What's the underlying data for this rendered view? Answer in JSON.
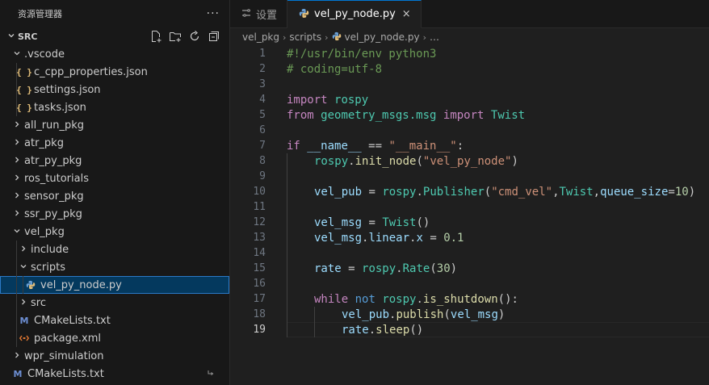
{
  "explorer": {
    "title": "资源管理器",
    "more": "···",
    "section": "SRC",
    "tree": [
      {
        "label": ".vscode",
        "type": "folder",
        "open": true,
        "depth": 1
      },
      {
        "label": "c_cpp_properties.json",
        "type": "json",
        "depth": 2
      },
      {
        "label": "settings.json",
        "type": "json",
        "depth": 2
      },
      {
        "label": "tasks.json",
        "type": "json",
        "depth": 2
      },
      {
        "label": "all_run_pkg",
        "type": "folder",
        "open": false,
        "depth": 1
      },
      {
        "label": "atr_pkg",
        "type": "folder",
        "open": false,
        "depth": 1
      },
      {
        "label": "atr_py_pkg",
        "type": "folder",
        "open": false,
        "depth": 1
      },
      {
        "label": "ros_tutorials",
        "type": "folder",
        "open": false,
        "depth": 1
      },
      {
        "label": "sensor_pkg",
        "type": "folder",
        "open": false,
        "depth": 1
      },
      {
        "label": "ssr_py_pkg",
        "type": "folder",
        "open": false,
        "depth": 1
      },
      {
        "label": "vel_pkg",
        "type": "folder",
        "open": true,
        "depth": 1
      },
      {
        "label": "include",
        "type": "folder",
        "open": false,
        "depth": 2
      },
      {
        "label": "scripts",
        "type": "folder",
        "open": true,
        "depth": 2
      },
      {
        "label": "vel_py_node.py",
        "type": "python",
        "depth": 3,
        "selected": true
      },
      {
        "label": "src",
        "type": "folder",
        "open": false,
        "depth": 2
      },
      {
        "label": "CMakeLists.txt",
        "type": "cmake",
        "depth": 2
      },
      {
        "label": "package.xml",
        "type": "xml",
        "depth": 2
      },
      {
        "label": "wpr_simulation",
        "type": "folder",
        "open": false,
        "depth": 1
      },
      {
        "label": "CMakeLists.txt",
        "type": "cmake",
        "depth": 1,
        "linked": true
      }
    ]
  },
  "tabs": [
    {
      "label": "设置",
      "icon": "settings-icon",
      "active": false
    },
    {
      "label": "vel_py_node.py",
      "icon": "python-icon",
      "active": true,
      "close": "×"
    }
  ],
  "breadcrumb": [
    "vel_pkg",
    "scripts",
    "vel_py_node.py",
    "…"
  ],
  "editor": {
    "current_line": 19,
    "lines": [
      {
        "n": "1",
        "indent": 0,
        "tokens": [
          [
            "cm",
            "#!/usr/bin/env python3"
          ]
        ]
      },
      {
        "n": "2",
        "indent": 0,
        "tokens": [
          [
            "cm",
            "# coding=utf-8"
          ]
        ]
      },
      {
        "n": "3",
        "indent": 0,
        "tokens": []
      },
      {
        "n": "4",
        "indent": 0,
        "tokens": [
          [
            "kw",
            "import"
          ],
          [
            "",
            " "
          ],
          [
            "md",
            "rospy"
          ]
        ]
      },
      {
        "n": "5",
        "indent": 0,
        "tokens": [
          [
            "kw",
            "from"
          ],
          [
            "",
            " "
          ],
          [
            "md",
            "geometry_msgs.msg"
          ],
          [
            "",
            " "
          ],
          [
            "kw",
            "import"
          ],
          [
            "",
            " "
          ],
          [
            "md",
            "Twist"
          ]
        ]
      },
      {
        "n": "6",
        "indent": 0,
        "tokens": []
      },
      {
        "n": "7",
        "indent": 0,
        "tokens": [
          [
            "kw",
            "if"
          ],
          [
            "",
            " "
          ],
          [
            "vr",
            "__name__"
          ],
          [
            "",
            " == "
          ],
          [
            "st",
            "\"__main__\""
          ],
          [
            "",
            ":"
          ]
        ]
      },
      {
        "n": "8",
        "indent": 1,
        "tokens": [
          [
            "md",
            "rospy"
          ],
          [
            "",
            "."
          ],
          [
            "fn",
            "init_node"
          ],
          [
            "",
            "("
          ],
          [
            "st",
            "\"vel_py_node\""
          ],
          [
            "",
            ")"
          ]
        ]
      },
      {
        "n": "9",
        "indent": 1,
        "tokens": []
      },
      {
        "n": "10",
        "indent": 1,
        "tokens": [
          [
            "vr",
            "vel_pub"
          ],
          [
            "",
            " = "
          ],
          [
            "md",
            "rospy"
          ],
          [
            "",
            "."
          ],
          [
            "md",
            "Publisher"
          ],
          [
            "",
            "("
          ],
          [
            "st",
            "\"cmd_vel\""
          ],
          [
            "",
            ","
          ],
          [
            "md",
            "Twist"
          ],
          [
            "",
            ","
          ],
          [
            "vr",
            "queue_size"
          ],
          [
            "",
            "="
          ],
          [
            "nm",
            "10"
          ],
          [
            "",
            ")"
          ]
        ]
      },
      {
        "n": "11",
        "indent": 1,
        "tokens": []
      },
      {
        "n": "12",
        "indent": 1,
        "tokens": [
          [
            "vr",
            "vel_msg"
          ],
          [
            "",
            " = "
          ],
          [
            "md",
            "Twist"
          ],
          [
            "",
            "()"
          ]
        ]
      },
      {
        "n": "13",
        "indent": 1,
        "tokens": [
          [
            "vr",
            "vel_msg"
          ],
          [
            "",
            "."
          ],
          [
            "vr",
            "linear"
          ],
          [
            "",
            "."
          ],
          [
            "vr",
            "x"
          ],
          [
            "",
            " = "
          ],
          [
            "nm",
            "0.1"
          ]
        ]
      },
      {
        "n": "14",
        "indent": 1,
        "tokens": []
      },
      {
        "n": "15",
        "indent": 1,
        "tokens": [
          [
            "vr",
            "rate"
          ],
          [
            "",
            " = "
          ],
          [
            "md",
            "rospy"
          ],
          [
            "",
            "."
          ],
          [
            "md",
            "Rate"
          ],
          [
            "",
            "("
          ],
          [
            "nm",
            "30"
          ],
          [
            "",
            ")"
          ]
        ]
      },
      {
        "n": "16",
        "indent": 1,
        "tokens": []
      },
      {
        "n": "17",
        "indent": 1,
        "tokens": [
          [
            "kw",
            "while"
          ],
          [
            "",
            " "
          ],
          [
            "kb",
            "not"
          ],
          [
            "",
            " "
          ],
          [
            "md",
            "rospy"
          ],
          [
            "",
            "."
          ],
          [
            "fn",
            "is_shutdown"
          ],
          [
            "",
            "():"
          ]
        ]
      },
      {
        "n": "18",
        "indent": 2,
        "tokens": [
          [
            "vr",
            "vel_pub"
          ],
          [
            "",
            "."
          ],
          [
            "fn",
            "publish"
          ],
          [
            "",
            "("
          ],
          [
            "vr",
            "vel_msg"
          ],
          [
            "",
            ")"
          ]
        ]
      },
      {
        "n": "19",
        "indent": 2,
        "tokens": [
          [
            "vr",
            "rate"
          ],
          [
            "",
            "."
          ],
          [
            "fn",
            "sleep"
          ],
          [
            "",
            "()"
          ]
        ]
      }
    ]
  }
}
